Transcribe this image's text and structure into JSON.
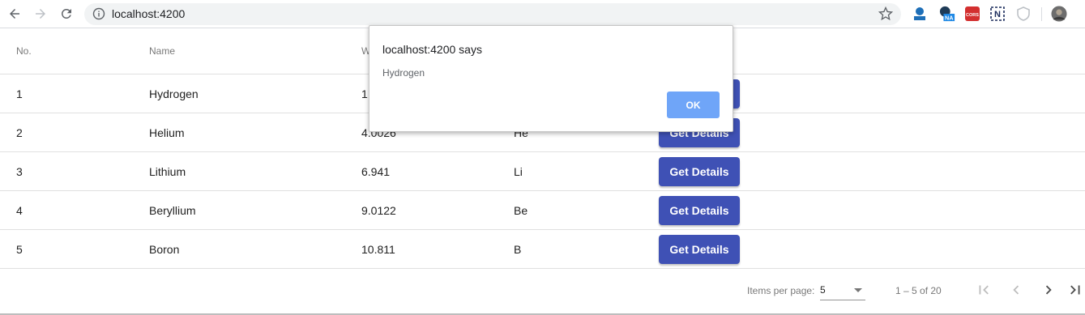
{
  "browser": {
    "url": "localhost:4200",
    "extensions": [
      "extension-1-icon",
      "extension-na-icon",
      "cors-extension-icon",
      "notion-extension-icon",
      "shield-extension-icon"
    ],
    "extension_badges": {
      "na": "NA",
      "cors": "CORS",
      "n": "N"
    }
  },
  "table": {
    "headers": {
      "no": "No.",
      "name": "Name",
      "weight": "W",
      "symbol": ""
    },
    "action_label": "Get Details",
    "rows": [
      {
        "no": "1",
        "name": "Hydrogen",
        "weight": "1",
        "symbol": ""
      },
      {
        "no": "2",
        "name": "Helium",
        "weight": "4.0026",
        "symbol": "He"
      },
      {
        "no": "3",
        "name": "Lithium",
        "weight": "6.941",
        "symbol": "Li"
      },
      {
        "no": "4",
        "name": "Beryllium",
        "weight": "9.0122",
        "symbol": "Be"
      },
      {
        "no": "5",
        "name": "Boron",
        "weight": "10.811",
        "symbol": "B"
      }
    ]
  },
  "paginator": {
    "items_per_page_label": "Items per page:",
    "page_size": "5",
    "range_label": "1 – 5 of 20"
  },
  "dialog": {
    "title": "localhost:4200 says",
    "message": "Hydrogen",
    "ok_label": "OK"
  },
  "colors": {
    "primary": "#3f51b5",
    "dialog_ok": "#6fa5f8"
  }
}
